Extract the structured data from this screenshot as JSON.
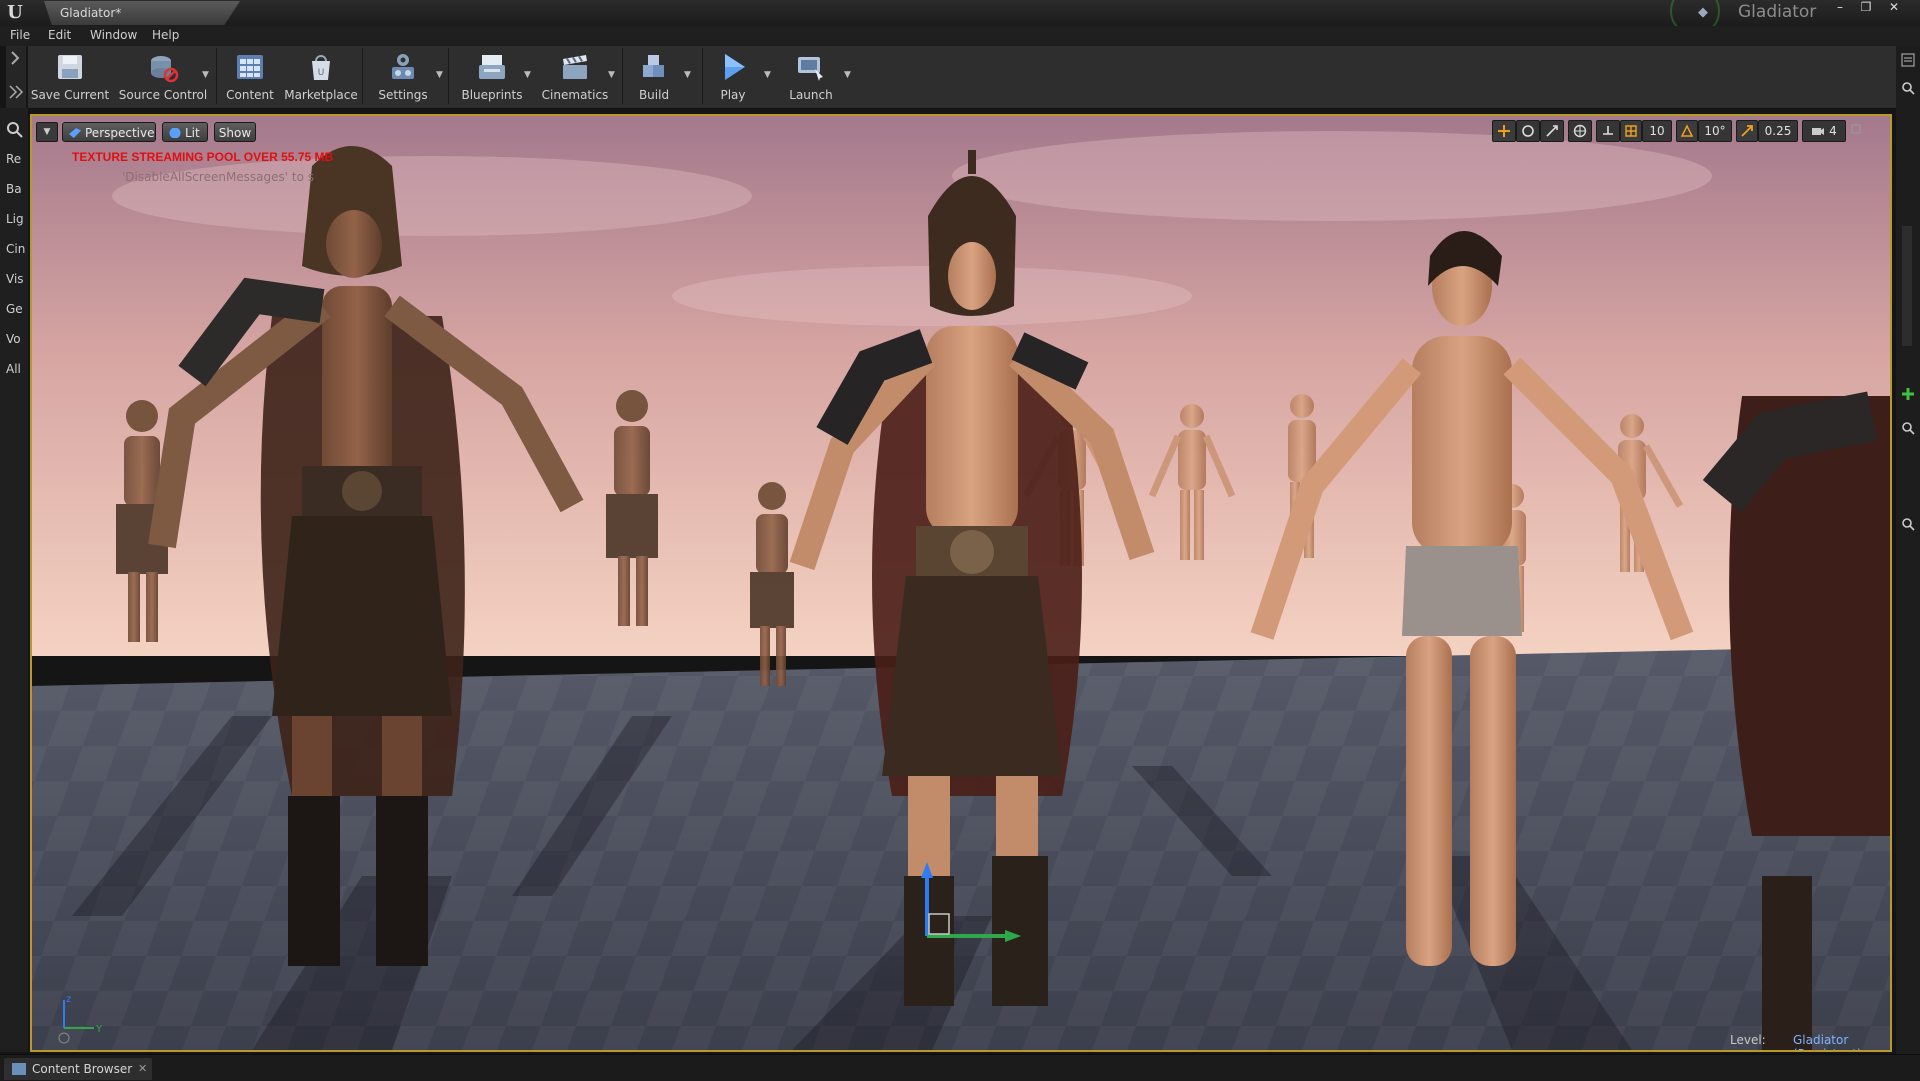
{
  "window": {
    "document_tab": "Gladiator*",
    "project_name": "Gladiator",
    "controls": [
      "–",
      "❐",
      "✕"
    ]
  },
  "menu": [
    "File",
    "Edit",
    "Window",
    "Help"
  ],
  "toolbar": {
    "buttons": [
      {
        "label": "Save Current",
        "icon": "save-icon",
        "dropdown": false
      },
      {
        "label": "Source Control",
        "icon": "source-control-icon",
        "dropdown": true
      },
      {
        "label": "Content",
        "icon": "content-icon",
        "dropdown": false
      },
      {
        "label": "Marketplace",
        "icon": "marketplace-icon",
        "dropdown": false
      },
      {
        "label": "Settings",
        "icon": "settings-icon",
        "dropdown": true
      },
      {
        "label": "Blueprints",
        "icon": "blueprints-icon",
        "dropdown": true
      },
      {
        "label": "Cinematics",
        "icon": "cinematics-icon",
        "dropdown": true
      },
      {
        "label": "Build",
        "icon": "build-icon",
        "dropdown": true
      },
      {
        "label": "Play",
        "icon": "play-icon",
        "dropdown": true
      },
      {
        "label": "Launch",
        "icon": "launch-icon",
        "dropdown": true
      }
    ]
  },
  "left_strip": {
    "tabs": [
      "Re",
      "Ba",
      "Lig",
      "Cin",
      "Vis",
      "Ge",
      "Vo",
      "All"
    ]
  },
  "viewport": {
    "view_mode": "Perspective",
    "lighting": "Lit",
    "show": "Show",
    "warning": "TEXTURE STREAMING POOL OVER 55.75 MB",
    "warning_sub": "'DisableAllScreenMessages' to s",
    "grid_snap": "10",
    "rotation_snap": "10°",
    "scale_snap": "0.25",
    "camera_speed": "4",
    "level_label": "Level:",
    "level_name": "Gladiator (Persistent)",
    "axis_labels": {
      "z": "z",
      "y": "Y"
    }
  },
  "bottom": {
    "content_browser_tab": "Content Browser"
  },
  "colors": {
    "viewport_border": "#b79a2a",
    "warning": "#e01010",
    "level_link": "#7fb4ff",
    "accent_orange": "#f0a020"
  }
}
